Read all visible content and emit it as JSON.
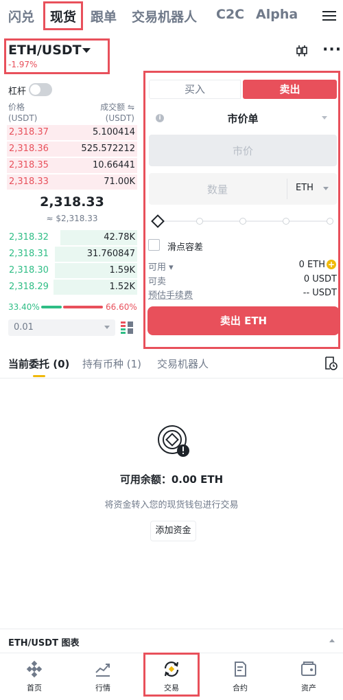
{
  "top_nav": {
    "tabs": [
      "闪兑",
      "现货",
      "跟单",
      "交易机器人",
      "C2C",
      "Alpha"
    ],
    "active": "现货"
  },
  "pair": {
    "symbol": "ETH/USDT",
    "change": "-1.97%"
  },
  "orderbook": {
    "leverage_label": "杠杆",
    "col_price": "价格",
    "col_price_unit": "(USDT)",
    "col_amount": "成交额 ⇋",
    "col_amount_unit": "(USDT)",
    "asks": [
      {
        "price": "2,318.37",
        "amount": "5.100414"
      },
      {
        "price": "2,318.36",
        "amount": "525.572212"
      },
      {
        "price": "2,318.35",
        "amount": "10.66441"
      },
      {
        "price": "2,318.33",
        "amount": "71.00K"
      }
    ],
    "last_price": "2,318.33",
    "last_price_fiat": "≈ $2,318.33",
    "bids": [
      {
        "price": "2,318.32",
        "amount": "42.78K"
      },
      {
        "price": "2,318.31",
        "amount": "31.760847"
      },
      {
        "price": "2,318.30",
        "amount": "1.59K"
      },
      {
        "price": "2,318.29",
        "amount": "1.52K"
      }
    ],
    "buy_ratio": "33.40%",
    "sell_ratio": "66.60%",
    "buy_ratio_value": 33.4,
    "depth": "0.01"
  },
  "trade": {
    "buy_tab": "买入",
    "sell_tab": "卖出",
    "order_type": "市价单",
    "price_placeholder": "市价",
    "qty_placeholder": "数量",
    "qty_unit": "ETH",
    "slippage_label": "滑点容差",
    "available_label": "可用",
    "available_value": "0 ETH",
    "sellable_label": "可卖",
    "sellable_value": "0 USDT",
    "fee_label": "预估手续费",
    "fee_value": "-- USDT",
    "submit": "卖出 ETH"
  },
  "orders": {
    "tabs": [
      "当前委托 (0)",
      "持有币种 (1)",
      "交易机器人"
    ],
    "balance_text": "可用余额：0.00 ETH",
    "hint": "将资金转入您的现货钱包进行交易",
    "add_funds": "添加资金"
  },
  "chart_strip": "ETH/USDT 图表",
  "bottom_nav": [
    "首页",
    "行情",
    "交易",
    "合约",
    "资产"
  ],
  "colors": {
    "red": "#e8505b",
    "green": "#2ebd85",
    "yellow": "#f0b90b",
    "highlight": "#e8505b"
  }
}
